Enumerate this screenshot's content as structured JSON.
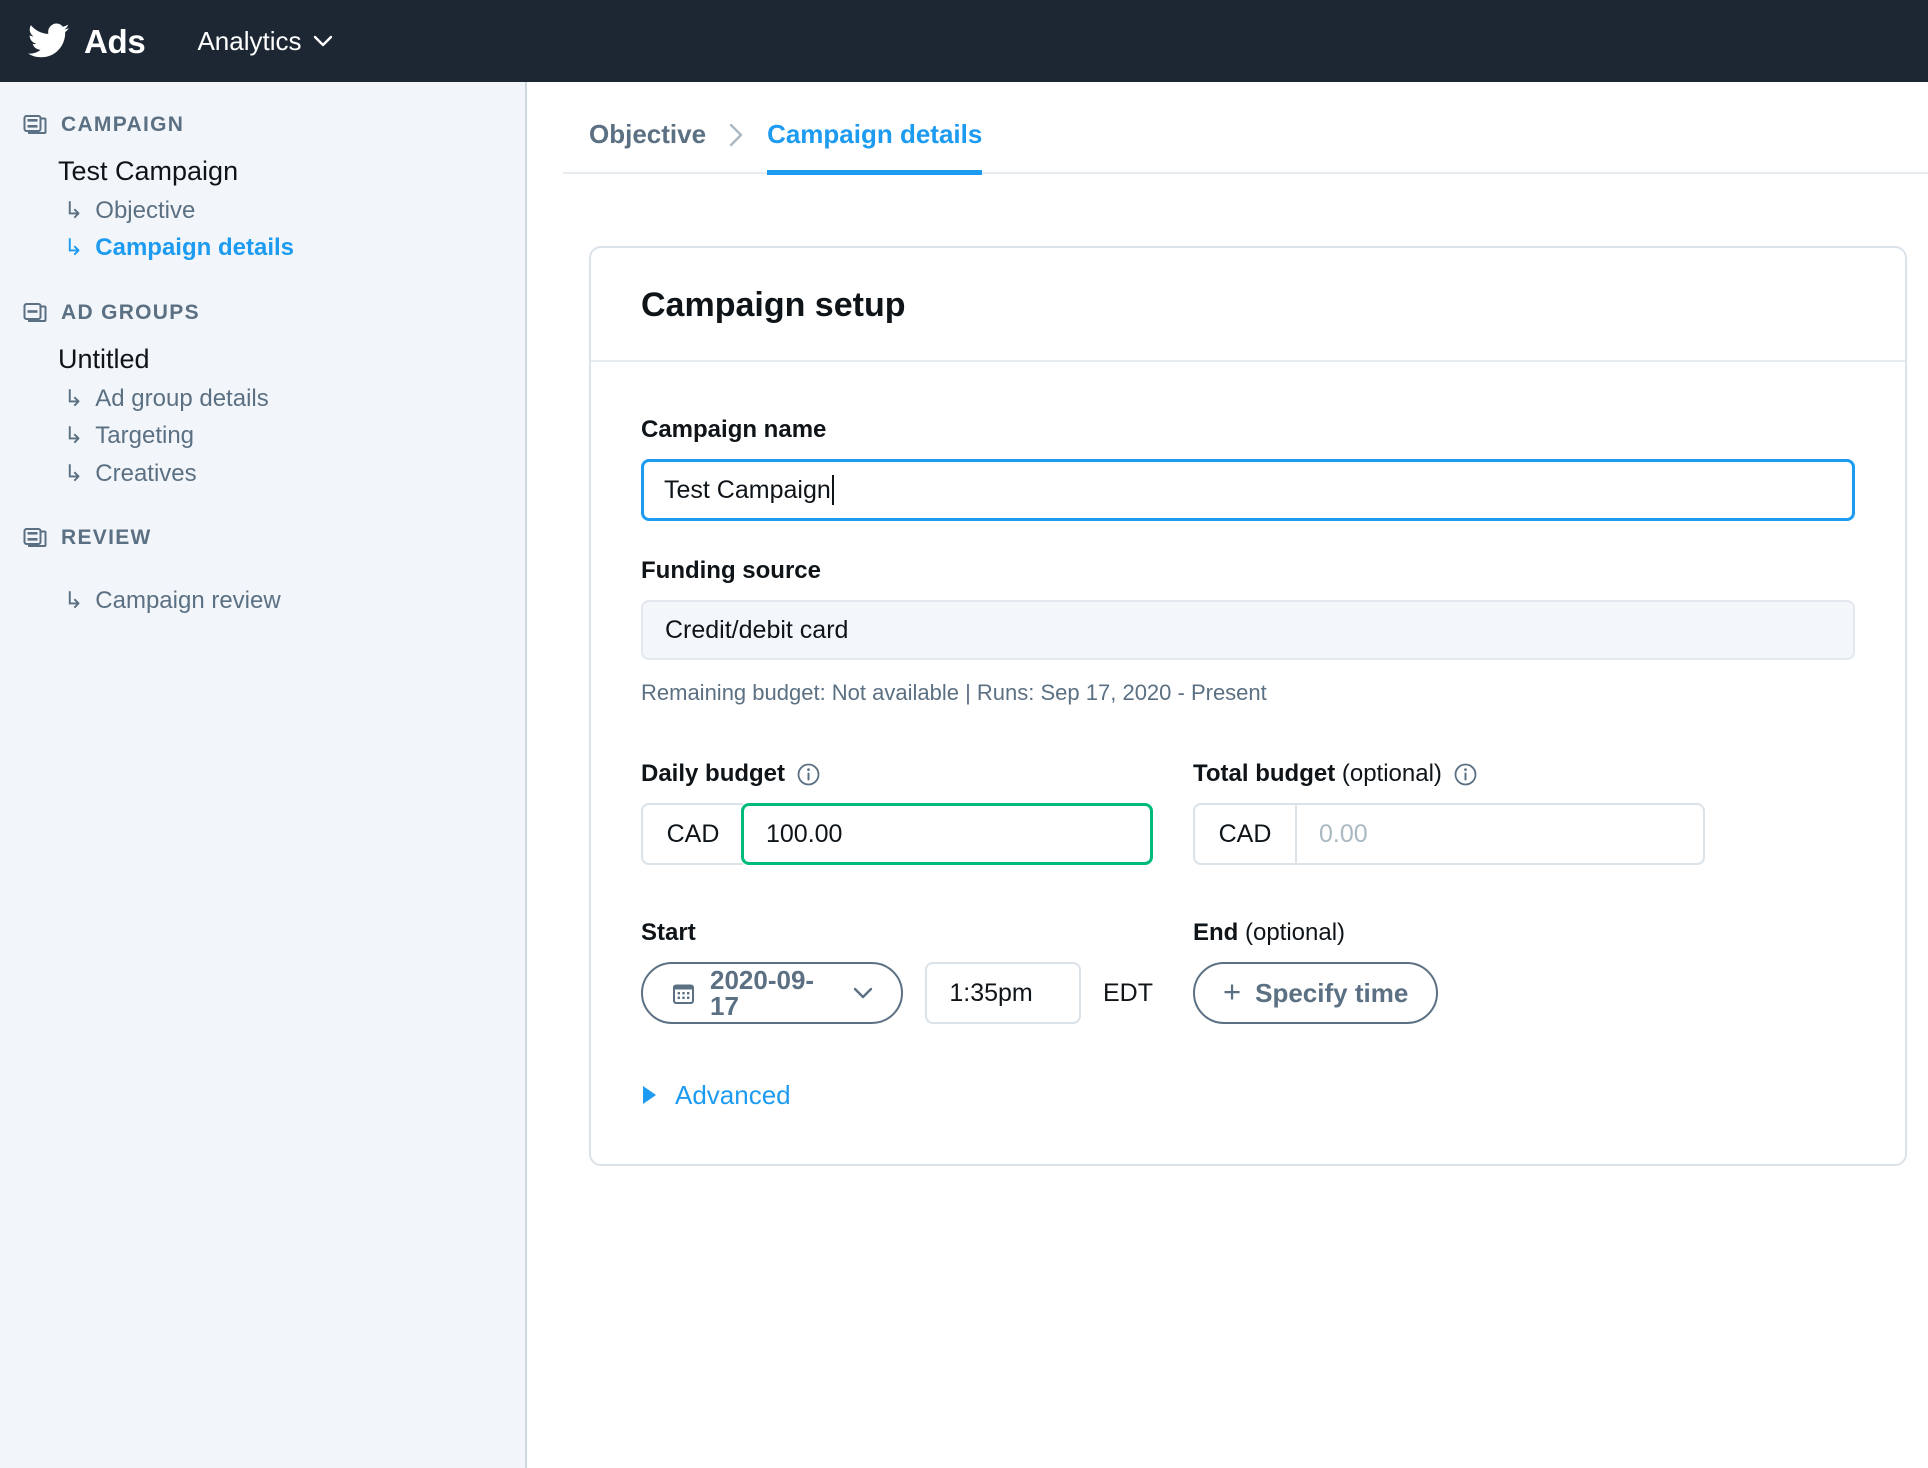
{
  "topbar": {
    "brand": "Ads",
    "bird_icon": "twitter-bird-icon",
    "menu_label": "Analytics",
    "chevron_icon": "chevron-down-icon"
  },
  "sidebar": {
    "sections": [
      {
        "icon": "campaign-list-icon",
        "title": "CAMPAIGN",
        "entity": "Test Campaign",
        "items": [
          {
            "label": "Objective",
            "active": false
          },
          {
            "label": "Campaign details",
            "active": true
          }
        ]
      },
      {
        "icon": "ad-groups-icon",
        "title": "AD GROUPS",
        "entity": "Untitled",
        "items": [
          {
            "label": "Ad group details",
            "active": false
          },
          {
            "label": "Targeting",
            "active": false
          },
          {
            "label": "Creatives",
            "active": false
          }
        ]
      },
      {
        "icon": "review-icon",
        "title": "REVIEW",
        "entity": "",
        "items": [
          {
            "label": "Campaign review",
            "active": false
          }
        ]
      }
    ]
  },
  "breadcrumb": {
    "objective": "Objective",
    "separator_icon": "chevron-right-icon",
    "campaign_details": "Campaign details"
  },
  "card": {
    "title": "Campaign setup",
    "campaign_name": {
      "label": "Campaign name",
      "value": "Test Campaign"
    },
    "funding_source": {
      "label": "Funding source",
      "value": "Credit/debit card",
      "helper": "Remaining budget: Not available | Runs: Sep 17, 2020 - Present"
    },
    "daily_budget": {
      "label": "Daily budget",
      "info_icon": "info-circle-icon",
      "currency": "CAD",
      "value": "100.00"
    },
    "total_budget": {
      "label": "Total budget",
      "optional": " (optional)",
      "info_icon": "info-circle-icon",
      "currency": "CAD",
      "placeholder": "0.00"
    },
    "start": {
      "label": "Start",
      "calendar_icon": "calendar-icon",
      "date": "2020-09-17",
      "chevron_icon": "chevron-down-icon",
      "time": "1:35pm",
      "timezone": "EDT"
    },
    "end": {
      "label": "End",
      "optional": " (optional)",
      "plus": "+",
      "button_label": "Specify time"
    },
    "advanced": {
      "triangle_icon": "triangle-right-icon",
      "label": "Advanced"
    }
  },
  "colors": {
    "brand_blue": "#1d9bf0",
    "topbar_dark": "#1c2733",
    "sidebar_bg": "#f2f6fa",
    "muted_text": "#5b7083",
    "valid_green": "#00ba7c"
  }
}
